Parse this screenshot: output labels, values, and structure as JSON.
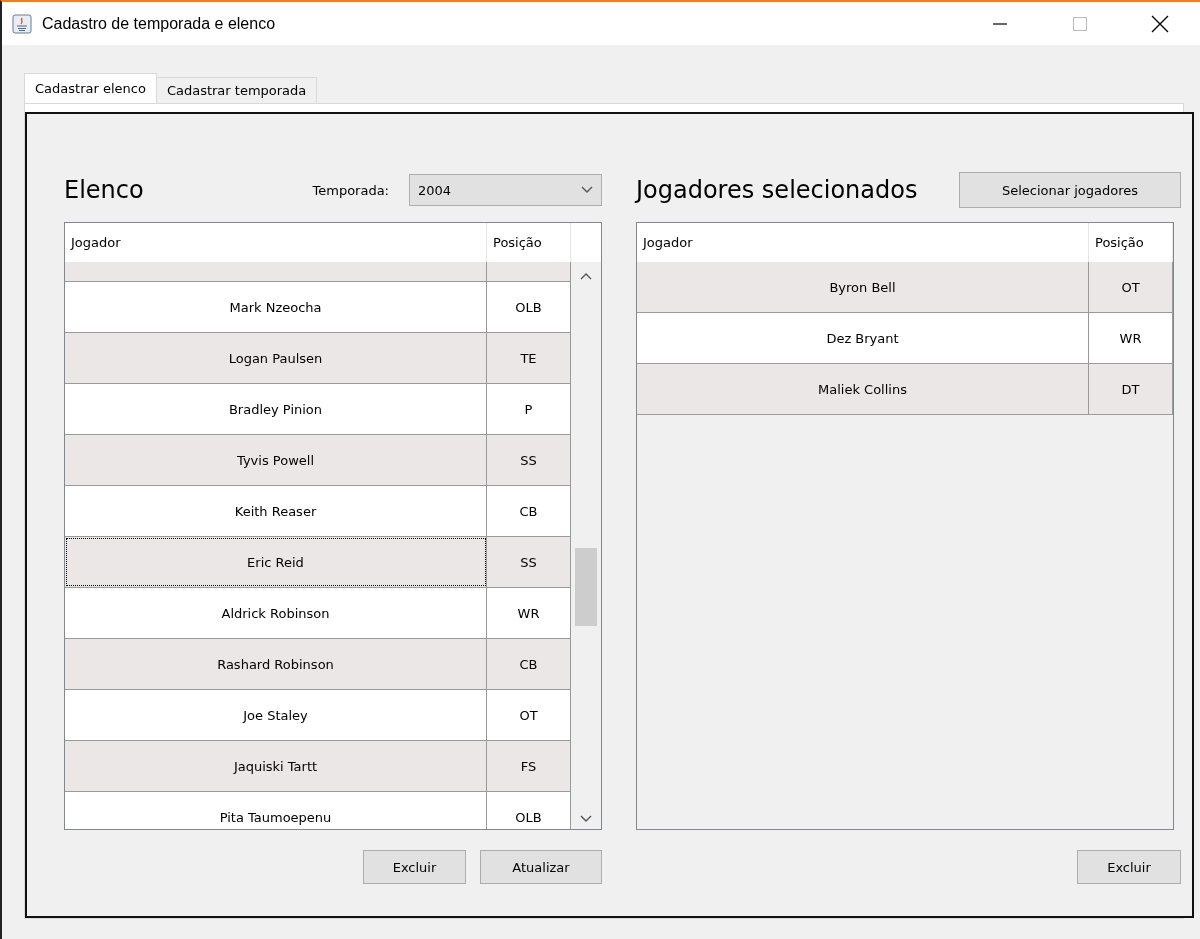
{
  "window": {
    "title": "Cadastro de temporada e elenco"
  },
  "tabs": [
    {
      "label": "Cadastrar elenco",
      "selected": true
    },
    {
      "label": "Cadastrar temporada",
      "selected": false
    }
  ],
  "roster": {
    "title": "Elenco",
    "season_label": "Temporada:",
    "season": "2004",
    "columns": [
      "Jogador",
      "Posição"
    ],
    "rows": [
      {
        "player": "Mark Nzeocha",
        "position": "OLB",
        "focused": false
      },
      {
        "player": "Logan Paulsen",
        "position": "TE",
        "focused": false
      },
      {
        "player": "Bradley Pinion",
        "position": "P",
        "focused": false
      },
      {
        "player": "Tyvis Powell",
        "position": "SS",
        "focused": false
      },
      {
        "player": "Keith Reaser",
        "position": "CB",
        "focused": false
      },
      {
        "player": "Eric Reid",
        "position": "SS",
        "focused": true
      },
      {
        "player": "Aldrick Robinson",
        "position": "WR",
        "focused": false
      },
      {
        "player": "Rashard Robinson",
        "position": "CB",
        "focused": false
      },
      {
        "player": "Joe Staley",
        "position": "OT",
        "focused": false
      },
      {
        "player": "Jaquiski Tartt",
        "position": "FS",
        "focused": false
      },
      {
        "player": "Pita Taumoepenu",
        "position": "OLB",
        "focused": false
      }
    ],
    "buttons": [
      "Excluir",
      "Atualizar"
    ]
  },
  "selected_players": {
    "title": "Jogadores selecionados",
    "select_button": "Selecionar jogadores",
    "columns": [
      "Jogador",
      "Posição"
    ],
    "rows": [
      {
        "player": "Byron Bell",
        "position": "OT"
      },
      {
        "player": "Dez Bryant",
        "position": "WR"
      },
      {
        "player": "Maliek Collins",
        "position": "DT"
      }
    ],
    "buttons": [
      "Excluir"
    ]
  }
}
